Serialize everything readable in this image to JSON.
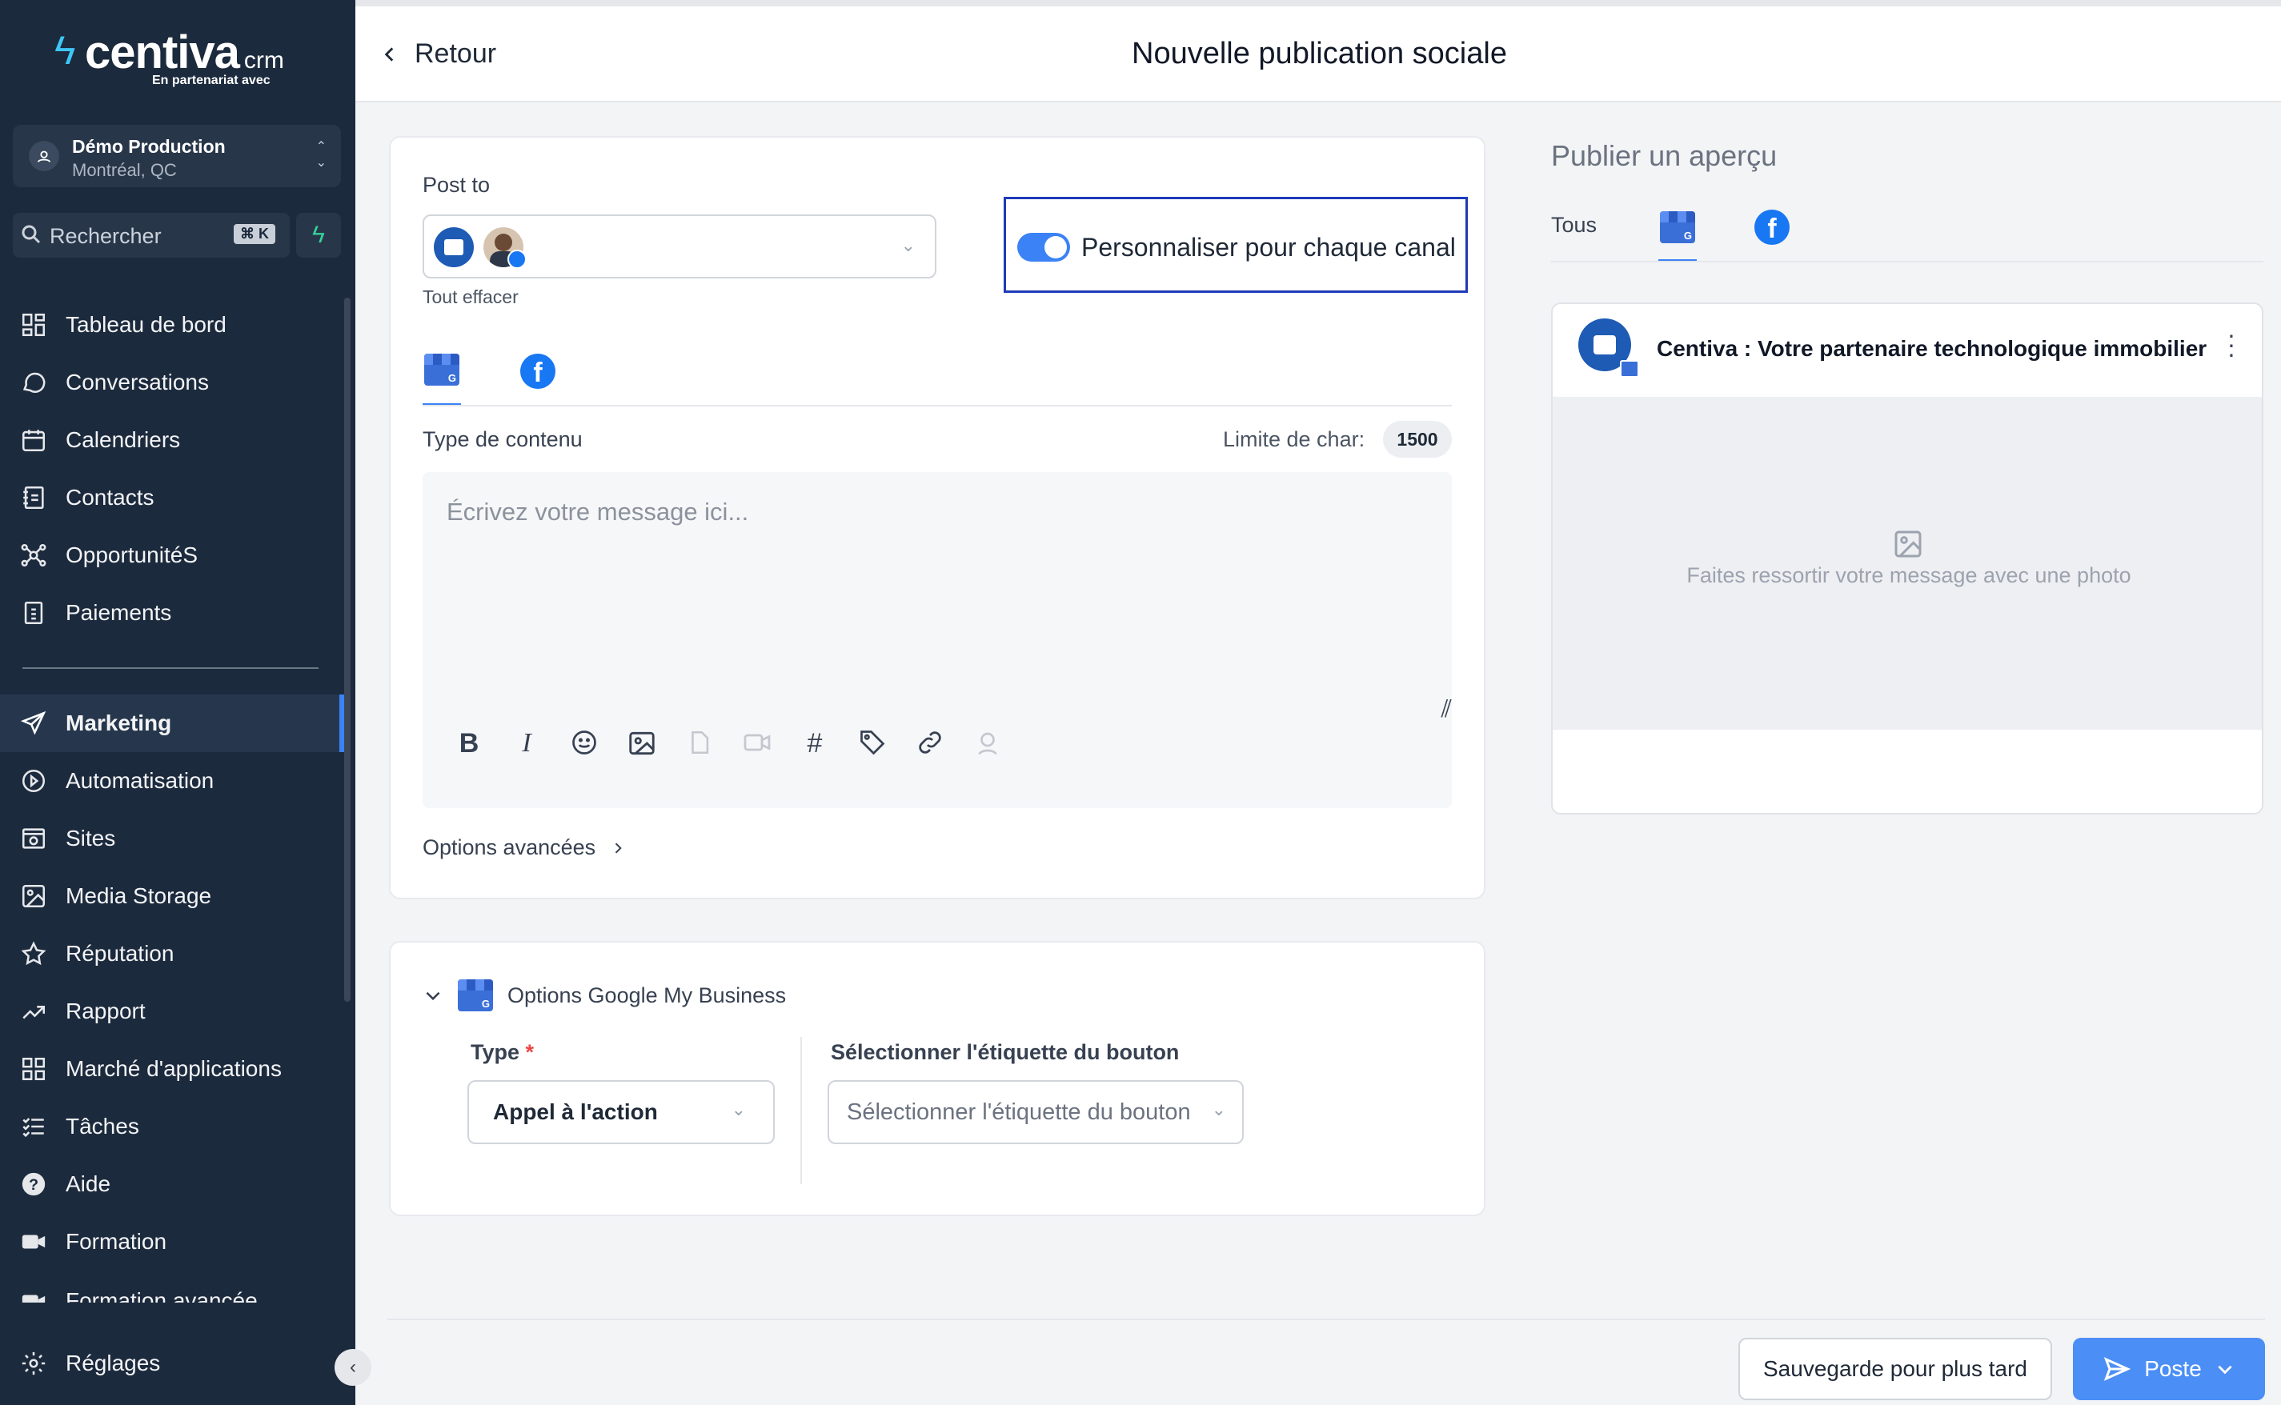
{
  "brand": {
    "name": "centiva",
    "suffix": "crm",
    "tagline": "En partenariat avec"
  },
  "account": {
    "name": "Démo Production",
    "location": "Montréal, QC"
  },
  "search": {
    "placeholder": "Rechercher",
    "shortcut": "⌘ K"
  },
  "nav": {
    "items": [
      {
        "label": "Tableau de bord",
        "icon": "dashboard-icon"
      },
      {
        "label": "Conversations",
        "icon": "chat-icon"
      },
      {
        "label": "Calendriers",
        "icon": "calendar-icon"
      },
      {
        "label": "Contacts",
        "icon": "contacts-icon"
      },
      {
        "label": "OpportunitéS",
        "icon": "opportunities-icon"
      },
      {
        "label": "Paiements",
        "icon": "payments-icon"
      },
      {
        "label": "Marketing",
        "icon": "send-icon",
        "active": true
      },
      {
        "label": "Automatisation",
        "icon": "automation-icon"
      },
      {
        "label": "Sites",
        "icon": "sites-icon"
      },
      {
        "label": "Media Storage",
        "icon": "image-icon"
      },
      {
        "label": "Réputation",
        "icon": "star-icon"
      },
      {
        "label": "Rapport",
        "icon": "trend-icon"
      },
      {
        "label": "Marché d'applications",
        "icon": "apps-icon"
      },
      {
        "label": "Tâches",
        "icon": "tasks-icon"
      },
      {
        "label": "Aide",
        "icon": "help-icon"
      },
      {
        "label": "Formation",
        "icon": "video-icon"
      },
      {
        "label": "Formation avancée",
        "icon": "video-icon"
      }
    ],
    "settings": "Réglages"
  },
  "header": {
    "back": "Retour",
    "title": "Nouvelle publication sociale"
  },
  "post": {
    "post_to_label": "Post to",
    "clear_all": "Tout effacer",
    "customize_label": "Personnaliser pour chaque canal",
    "customize_on": true,
    "content_type_label": "Type de contenu",
    "char_limit_label": "Limite de char:",
    "char_limit_value": "1500",
    "message_placeholder": "Écrivez votre message ici...",
    "advanced_options": "Options avancées"
  },
  "gmb": {
    "title": "Options Google My Business",
    "type_label": "Type",
    "type_value": "Appel à l'action",
    "button_label_label": "Sélectionner l'étiquette du bouton",
    "button_label_placeholder": "Sélectionner l'étiquette du bouton"
  },
  "preview": {
    "title": "Publier un aperçu",
    "tab_all": "Tous",
    "business_name": "Centiva : Votre partenaire technologique immobilier",
    "photo_hint": "Faites ressortir votre message avec une photo"
  },
  "footer": {
    "save_later": "Sauvegarde pour plus tard",
    "post": "Poste"
  },
  "colors": {
    "sidebar": "#1c2a3d",
    "accent": "#3b82f6",
    "highlight_border": "#1e3ab8"
  }
}
